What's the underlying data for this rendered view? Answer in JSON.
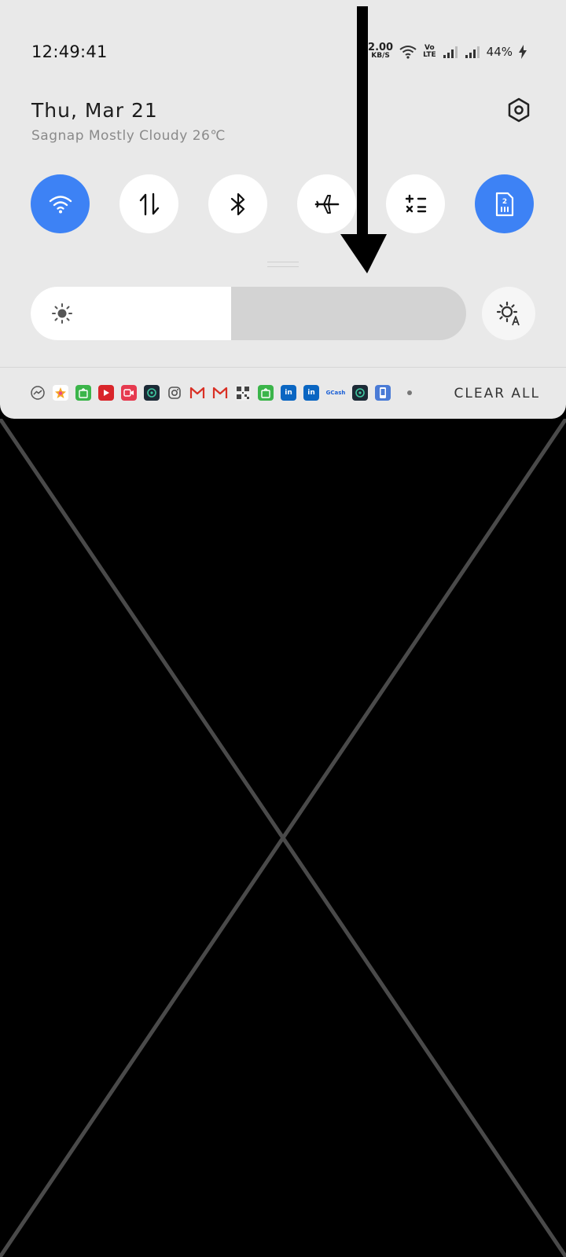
{
  "status_bar": {
    "time": "12:49:41",
    "net_speed_value": "2.00",
    "net_speed_unit": "KB/S",
    "volte_top": "Vo",
    "volte_bottom": "LTE",
    "battery": "44%",
    "icons": [
      "wifi-icon",
      "volte-icon",
      "signal-sim1-icon",
      "signal-sim2-icon",
      "charging-icon"
    ]
  },
  "header": {
    "date": "Thu, Mar 21",
    "weather": "Sagnap Mostly Cloudy 26℃"
  },
  "quick_tiles": [
    {
      "name": "wifi",
      "icon": "wifi-icon",
      "active": true
    },
    {
      "name": "mobile-data",
      "icon": "data-arrows-icon",
      "active": false
    },
    {
      "name": "bluetooth",
      "icon": "bluetooth-icon",
      "active": false
    },
    {
      "name": "airplane-mode",
      "icon": "airplane-icon",
      "active": false
    },
    {
      "name": "calculator",
      "icon": "calculator-icon",
      "active": false
    },
    {
      "name": "sim-card",
      "icon": "sim-card-icon",
      "sim_label": "2",
      "active": true
    }
  ],
  "brightness": {
    "level": 0.46,
    "auto_icon": "auto-brightness-icon"
  },
  "notifications": {
    "app_icons": [
      "messenger",
      "photos",
      "shopping",
      "youtube",
      "video",
      "ai-app",
      "instagram",
      "gmail",
      "gmail",
      "qr-app",
      "shopping",
      "linkedin",
      "linkedin",
      "gcash",
      "ai-app",
      "phone-app"
    ],
    "gcash_label": "GCash",
    "linkedin_label": "in",
    "clear_all": "CLEAR ALL"
  },
  "colors": {
    "panel": "#e9e9e9",
    "accent": "#3d82f5",
    "background": "#000000"
  }
}
